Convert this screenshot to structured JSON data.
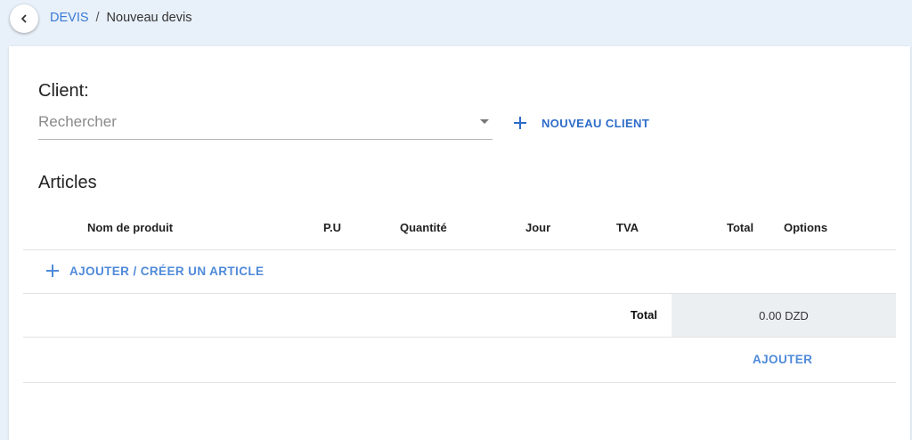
{
  "breadcrumb": {
    "parent": "DEVIS",
    "separator": "/",
    "current": "Nouveau devis"
  },
  "client": {
    "title": "Client:",
    "search_placeholder": "Rechercher",
    "new_client_label": "NOUVEAU CLIENT"
  },
  "articles": {
    "title": "Articles",
    "columns": [
      "Nom de produit",
      "P.U",
      "Quantité",
      "Jour",
      "TVA",
      "Total",
      "Options"
    ],
    "add_label": "AJOUTER / CRÉER UN ARTICLE",
    "total_label": "Total",
    "total_value": "0.00 DZD",
    "submit_label": "AJOUTER"
  },
  "colors": {
    "accent": "#2d6cc9",
    "accent_light": "#4f8ad9",
    "link": "#3a7bd5",
    "background": "#e8f0fa",
    "total_cell": "#eceff2"
  },
  "icons": {
    "back": "chevron-left-icon",
    "dropdown": "caret-down-icon",
    "add": "plus-icon"
  }
}
